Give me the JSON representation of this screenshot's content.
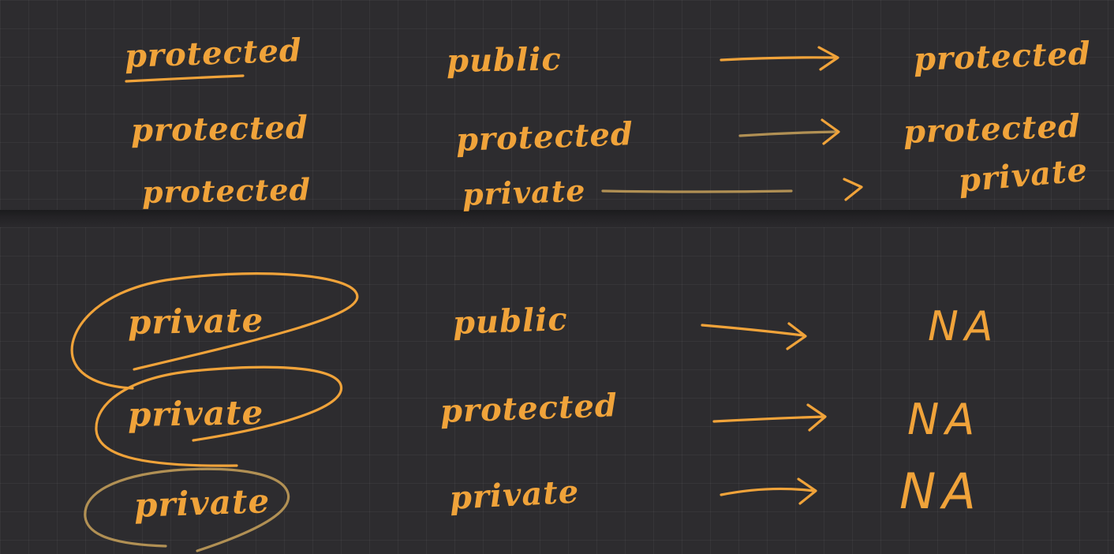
{
  "ink_color": "#f0a33a",
  "background_color": "#2d2c2f",
  "section_protected": {
    "rows": [
      {
        "base": "protected",
        "mode": "public",
        "result": "protected"
      },
      {
        "base": "protected",
        "mode": "protected",
        "result": "protected"
      },
      {
        "base": "protected",
        "mode": "private",
        "result": "private"
      }
    ]
  },
  "section_private": {
    "rows": [
      {
        "base": "private",
        "mode": "public",
        "result": "NA"
      },
      {
        "base": "private",
        "mode": "protected",
        "result": "NA"
      },
      {
        "base": "private",
        "mode": "private",
        "result": "NA"
      }
    ]
  }
}
